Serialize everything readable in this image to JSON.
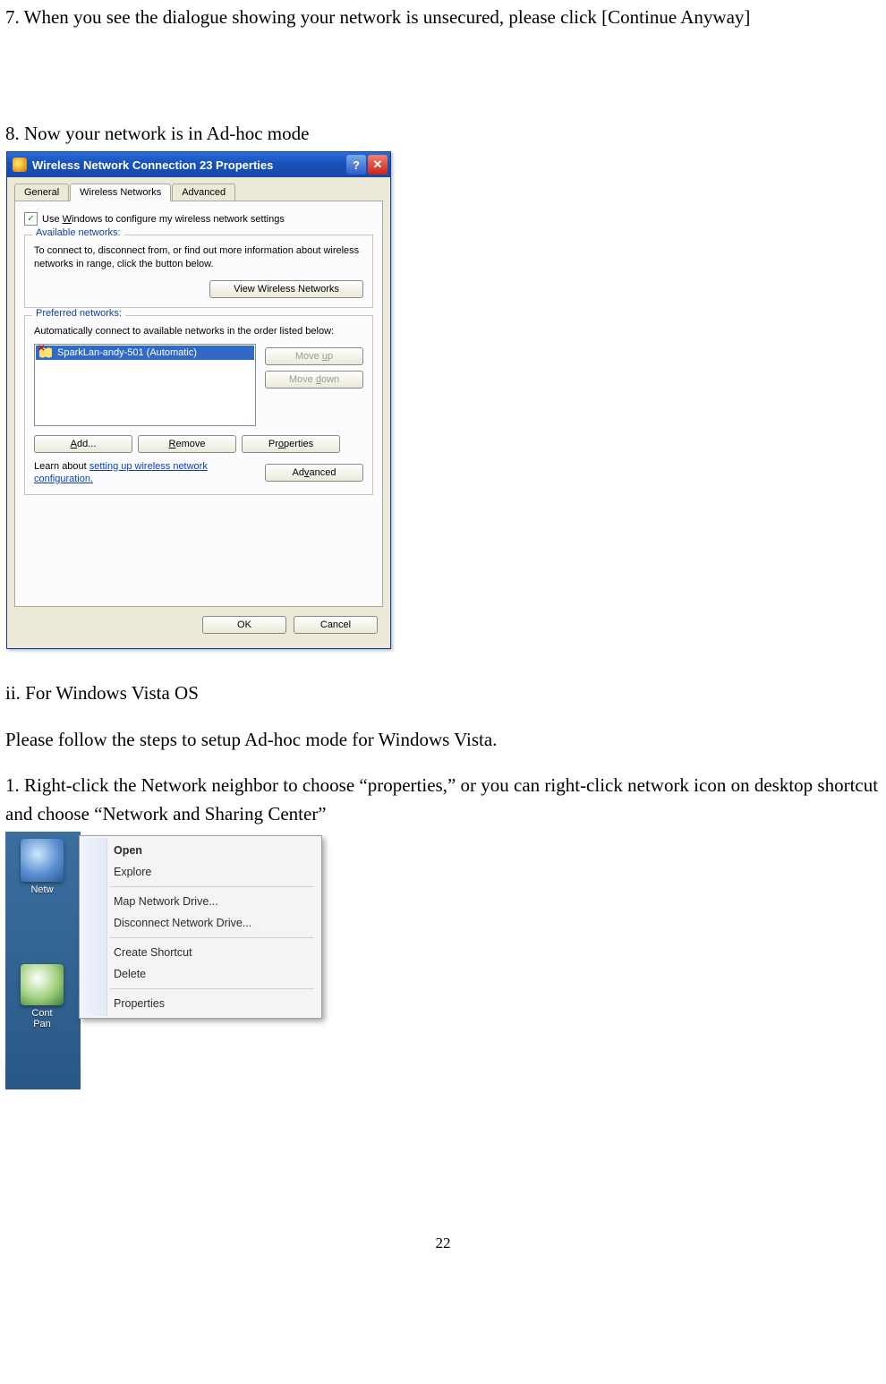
{
  "page_number": "22",
  "text": {
    "step7": "7. When you see the dialogue showing your network is unsecured, please click [Continue Anyway]",
    "step8": "8. Now your network is in Ad-hoc mode",
    "section_ii": "ii. For Windows Vista OS",
    "section_ii_intro": "Please follow the steps to setup Ad-hoc mode for Windows Vista.",
    "vista_step1": "1. Right-click the Network neighbor to choose “properties,” or you can right-click network icon on desktop shortcut and choose “Network and Sharing Center”"
  },
  "xp_dialog": {
    "title": "Wireless Network Connection 23 Properties",
    "tabs": {
      "general": "General",
      "wireless": "Wireless Networks",
      "advanced": "Advanced"
    },
    "use_windows_label": "Use Windows to configure my wireless network settings",
    "available_legend": "Available networks:",
    "available_note": "To connect to, disconnect from, or find out more information about wireless networks in range, click the button below.",
    "view_wireless_btn": "View Wireless Networks",
    "preferred_legend": "Preferred networks:",
    "preferred_note": "Automatically connect to available networks in the order listed below:",
    "list_item": "SparkLan-andy-501 (Automatic)",
    "move_up_btn": "Move up",
    "move_down_btn": "Move down",
    "add_btn": "Add...",
    "remove_btn": "Remove",
    "properties_btn": "Properties",
    "learn_prefix": "Learn about ",
    "learn_link": "setting up wireless network configuration.",
    "advanced_btn": "Advanced",
    "ok_btn": "OK",
    "cancel_btn": "Cancel"
  },
  "vista": {
    "desktop_icons": {
      "network": "Netw",
      "control_panel": "Cont\nPan"
    },
    "menu": {
      "open": "Open",
      "explore": "Explore",
      "map": "Map Network Drive...",
      "disconnect": "Disconnect Network Drive...",
      "create_shortcut": "Create Shortcut",
      "delete": "Delete",
      "properties": "Properties"
    }
  }
}
